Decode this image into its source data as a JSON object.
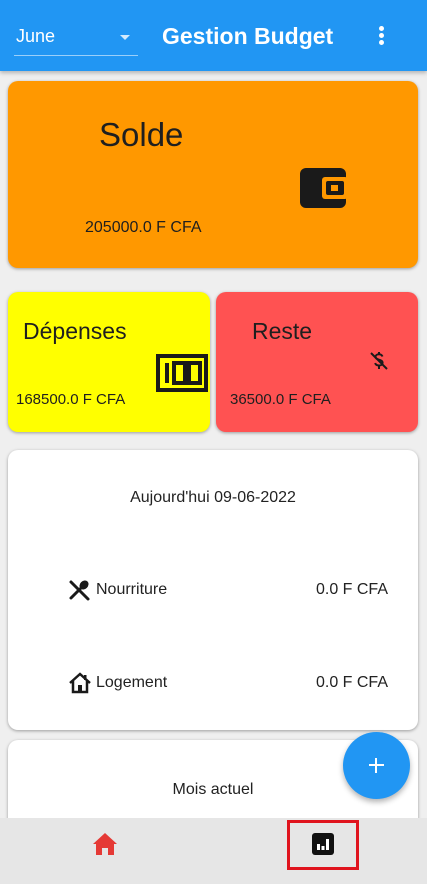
{
  "appbar": {
    "month_selected": "June",
    "title": "Gestion Budget",
    "menu_icon": "more-vert-icon",
    "color": "#2196f3"
  },
  "solde": {
    "label": "Solde",
    "amount": "205000.0 F CFA",
    "icon": "wallet-icon",
    "color": "#ff9800"
  },
  "depenses": {
    "label": "Dépenses",
    "amount": "168500.0 F CFA",
    "icon": "hundred-icon",
    "color": "#ffff00"
  },
  "reste": {
    "label": "Reste",
    "amount": "36500.0 F CFA",
    "icon": "money-off-icon",
    "color": "#ff5252"
  },
  "today": {
    "heading": "Aujourd'hui 09-06-2022",
    "items": [
      {
        "icon": "restaurant-icon",
        "name": "Nourriture",
        "value": "0.0 F CFA"
      },
      {
        "icon": "house-icon",
        "name": "Logement",
        "value": "0.0 F CFA"
      }
    ]
  },
  "mois": {
    "heading": "Mois actuel"
  },
  "fab": {
    "icon": "add-icon"
  },
  "bottom_nav": {
    "items": [
      {
        "icon": "home-icon",
        "active_color": "#e53935"
      },
      {
        "icon": "analytics-icon",
        "highlight_color": "#e0141e"
      }
    ]
  }
}
